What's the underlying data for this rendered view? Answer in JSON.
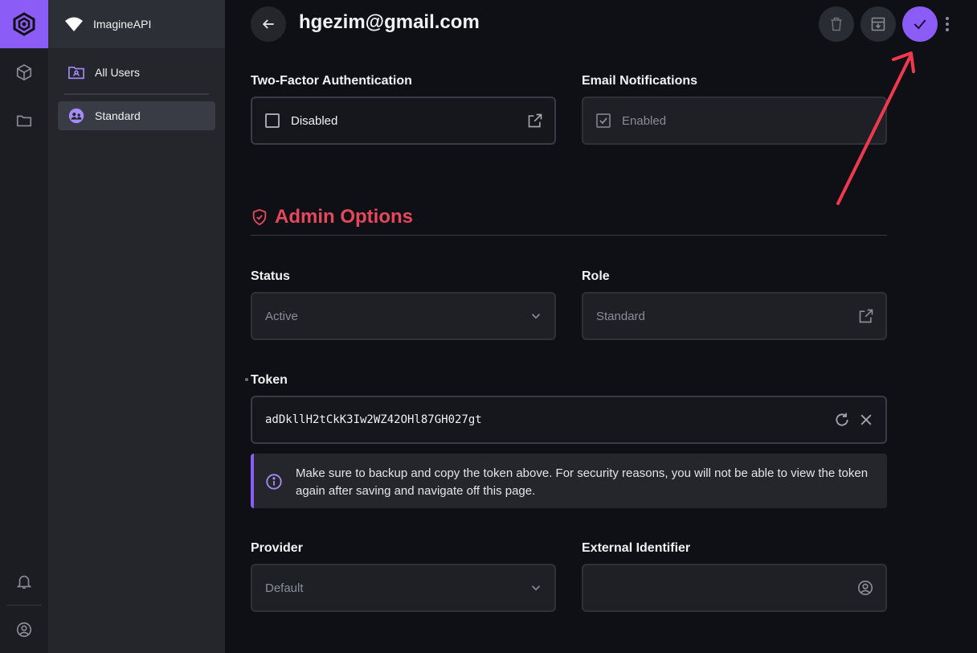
{
  "project": {
    "name": "ImagineAPI"
  },
  "sidebar": {
    "items": [
      {
        "label": "All Users",
        "icon": "folder-user-icon"
      },
      {
        "label": "Standard",
        "icon": "user-group-icon"
      }
    ]
  },
  "header": {
    "title": "hgezim@gmail.com",
    "actions": [
      "delete-icon",
      "archive-icon",
      "check-icon",
      "more-vertical-icon"
    ]
  },
  "fields": {
    "two_factor": {
      "label": "Two-Factor Authentication",
      "value": "Disabled"
    },
    "email_notifications": {
      "label": "Email Notifications",
      "value": "Enabled"
    },
    "status": {
      "label": "Status",
      "value": "Active"
    },
    "role": {
      "label": "Role",
      "value": "Standard"
    },
    "token": {
      "label": "Token",
      "value": "adDkllH2tCkK3Iw2WZ42OHl87GH027gt"
    },
    "provider": {
      "label": "Provider",
      "value": "Default"
    },
    "external_identifier": {
      "label": "External Identifier",
      "value": ""
    }
  },
  "admin": {
    "title": "Admin Options"
  },
  "notice": {
    "text": "Make sure to backup and copy the token above. For security reasons, you will not be able to view the token again after saving and navigate off this page."
  },
  "colors": {
    "accent": "#8b5cf6",
    "danger": "#e5485d",
    "annotation": "#f0384f"
  }
}
